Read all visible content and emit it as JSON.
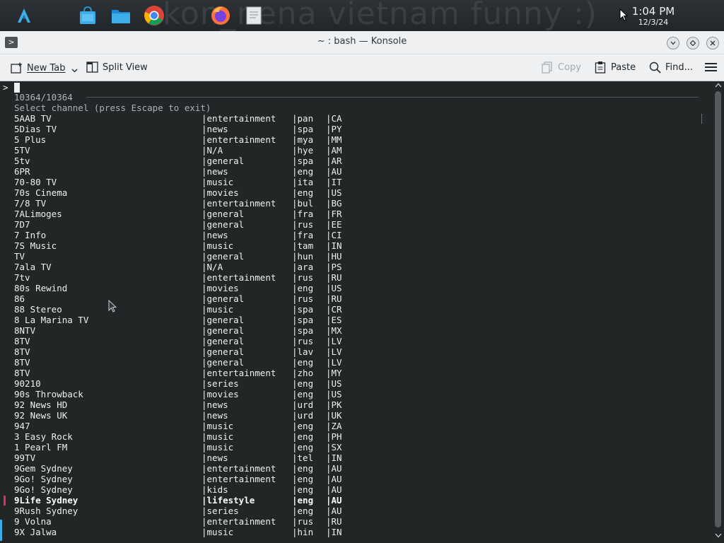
{
  "taskbar": {
    "wallpaper_text": "kon_nena vietnam funny :)",
    "clock_time": "1:04 PM",
    "clock_date": "12/3/24"
  },
  "window": {
    "title": "~ : bash — Konsole",
    "menu_glyph": ">"
  },
  "toolbar": {
    "new_tab": "New Tab",
    "split_view": "Split View",
    "copy": "Copy",
    "paste": "Paste",
    "find": "Find..."
  },
  "terminal": {
    "prompt": ">",
    "counter": "10364/10364",
    "header": "Select channel (press Escape to exit)",
    "rows": [
      {
        "name": "5AAB TV",
        "cat": "entertainment",
        "lang": "pan",
        "cc": "CA"
      },
      {
        "name": "5Dias TV",
        "cat": "news",
        "lang": "spa",
        "cc": "PY"
      },
      {
        "name": "5 Plus",
        "cat": "entertainment",
        "lang": "mya",
        "cc": "MM"
      },
      {
        "name": "5TV",
        "cat": "N/A",
        "lang": "hye",
        "cc": "AM"
      },
      {
        "name": "5tv",
        "cat": "general",
        "lang": "spa",
        "cc": "AR"
      },
      {
        "name": "6PR",
        "cat": "news",
        "lang": "eng",
        "cc": "AU"
      },
      {
        "name": "70-80 TV",
        "cat": "music",
        "lang": "ita",
        "cc": "IT"
      },
      {
        "name": "70s Cinema",
        "cat": "movies",
        "lang": "eng",
        "cc": "US"
      },
      {
        "name": "7/8 TV",
        "cat": "entertainment",
        "lang": "bul",
        "cc": "BG"
      },
      {
        "name": "7ALimoges",
        "cat": "general",
        "lang": "fra",
        "cc": "FR"
      },
      {
        "name": "7D7",
        "cat": "general",
        "lang": "rus",
        "cc": "EE"
      },
      {
        "name": "7 Info",
        "cat": "news",
        "lang": "fra",
        "cc": "CI"
      },
      {
        "name": "7S Music",
        "cat": "music",
        "lang": "tam",
        "cc": "IN"
      },
      {
        "name": "TV",
        "cat": "general",
        "lang": "hun",
        "cc": "HU"
      },
      {
        "name": "7ala TV",
        "cat": "N/A",
        "lang": "ara",
        "cc": "PS"
      },
      {
        "name": "7tv",
        "cat": "entertainment",
        "lang": "rus",
        "cc": "RU"
      },
      {
        "name": "80s Rewind",
        "cat": "movies",
        "lang": "eng",
        "cc": "US"
      },
      {
        "name": "86",
        "cat": "general",
        "lang": "rus",
        "cc": "RU"
      },
      {
        "name": "88 Stereo",
        "cat": "music",
        "lang": "spa",
        "cc": "CR"
      },
      {
        "name": "8 La Marina TV",
        "cat": "general",
        "lang": "spa",
        "cc": "ES"
      },
      {
        "name": "8NTV",
        "cat": "general",
        "lang": "spa",
        "cc": "MX"
      },
      {
        "name": "8TV",
        "cat": "general",
        "lang": "rus",
        "cc": "LV"
      },
      {
        "name": "8TV",
        "cat": "general",
        "lang": "lav",
        "cc": "LV"
      },
      {
        "name": "8TV",
        "cat": "general",
        "lang": "eng",
        "cc": "LV"
      },
      {
        "name": "8TV",
        "cat": "entertainment",
        "lang": "zho",
        "cc": "MY"
      },
      {
        "name": "90210",
        "cat": "series",
        "lang": "eng",
        "cc": "US"
      },
      {
        "name": "90s Throwback",
        "cat": "movies",
        "lang": "eng",
        "cc": "US"
      },
      {
        "name": "92 News HD",
        "cat": "news",
        "lang": "urd",
        "cc": "PK"
      },
      {
        "name": "92 News UK",
        "cat": "news",
        "lang": "urd",
        "cc": "UK"
      },
      {
        "name": "947",
        "cat": "music",
        "lang": "eng",
        "cc": "ZA"
      },
      {
        "name": "3 Easy Rock",
        "cat": "music",
        "lang": "eng",
        "cc": "PH"
      },
      {
        "name": "1 Pearl FM",
        "cat": "music",
        "lang": "eng",
        "cc": "SX"
      },
      {
        "name": "99TV",
        "cat": "news",
        "lang": "tel",
        "cc": "IN"
      },
      {
        "name": "9Gem Sydney",
        "cat": "entertainment",
        "lang": "eng",
        "cc": "AU"
      },
      {
        "name": "9Go! Sydney",
        "cat": "entertainment",
        "lang": "eng",
        "cc": "AU"
      },
      {
        "name": "9Go! Sydney",
        "cat": "kids",
        "lang": "eng",
        "cc": "AU"
      },
      {
        "name": "9Life Sydney",
        "cat": "lifestyle",
        "lang": "eng",
        "cc": "AU",
        "selected": true
      },
      {
        "name": "9Rush Sydney",
        "cat": "series",
        "lang": "eng",
        "cc": "AU"
      },
      {
        "name": "9 Volna",
        "cat": "entertainment",
        "lang": "rus",
        "cc": "RU"
      },
      {
        "name": "9X Jalwa",
        "cat": "music",
        "lang": "hin",
        "cc": "IN"
      }
    ]
  },
  "colors": {
    "terminal_bg": "#232627",
    "terminal_fg": "#eff0f1",
    "chrome_bg": "#eff0f1",
    "selection_marker": "#e32f5d",
    "accent_blue": "#3daee9"
  }
}
